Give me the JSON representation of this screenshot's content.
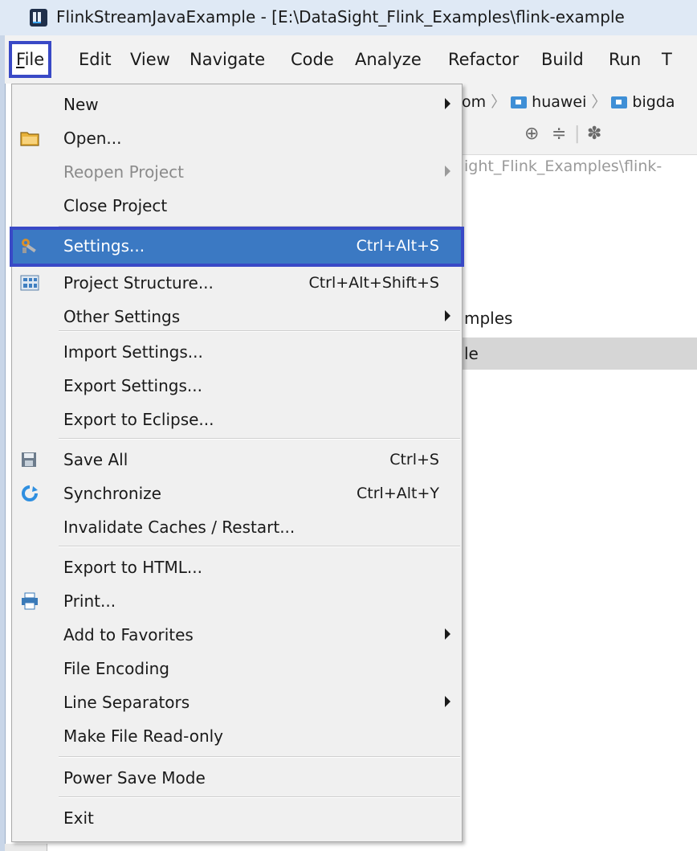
{
  "window": {
    "title": "FlinkStreamJavaExample - [E:\\DataSight_Flink_Examples\\flink-example"
  },
  "menubar": {
    "items": [
      {
        "label": "File",
        "active": true
      },
      {
        "label": "Edit"
      },
      {
        "label": "View"
      },
      {
        "label": "Navigate"
      },
      {
        "label": "Code"
      },
      {
        "label": "Analyze"
      },
      {
        "label": "Refactor"
      },
      {
        "label": "Build"
      },
      {
        "label": "Run"
      },
      {
        "label": "T"
      }
    ]
  },
  "background": {
    "breadcrumbs": [
      "om",
      "huawei",
      "bigda"
    ],
    "path_text": "ight_Flink_Examples\\flink-",
    "tree_items": [
      "mples",
      "le"
    ]
  },
  "file_menu": {
    "items": {
      "new": {
        "label": "New",
        "submenu": true
      },
      "open": {
        "label": "Open...",
        "icon": "folder-icon"
      },
      "reopen_project": {
        "label": "Reopen Project",
        "disabled": true,
        "submenu": true
      },
      "close_project": {
        "label": "Close Project"
      },
      "settings": {
        "label": "Settings...",
        "shortcut": "Ctrl+Alt+S",
        "icon": "settings-wrench-icon",
        "highlighted": true
      },
      "project_structure": {
        "label": "Project Structure...",
        "shortcut": "Ctrl+Alt+Shift+S",
        "icon": "project-structure-icon"
      },
      "other_settings": {
        "label": "Other Settings",
        "submenu": true
      },
      "import_settings": {
        "label": "Import Settings..."
      },
      "export_settings": {
        "label": "Export Settings..."
      },
      "export_to_eclipse": {
        "label": "Export to Eclipse..."
      },
      "save_all": {
        "label": "Save All",
        "shortcut": "Ctrl+S",
        "icon": "save-icon"
      },
      "synchronize": {
        "label": "Synchronize",
        "shortcut": "Ctrl+Alt+Y",
        "icon": "sync-icon"
      },
      "invalidate_caches": {
        "label": "Invalidate Caches / Restart..."
      },
      "export_to_html": {
        "label": "Export to HTML..."
      },
      "print": {
        "label": "Print...",
        "icon": "print-icon"
      },
      "add_to_favorites": {
        "label": "Add to Favorites",
        "submenu": true
      },
      "file_encoding": {
        "label": "File Encoding"
      },
      "line_separators": {
        "label": "Line Separators",
        "submenu": true
      },
      "make_read_only": {
        "label": "Make File Read-only"
      },
      "power_save_mode": {
        "label": "Power Save Mode"
      },
      "exit": {
        "label": "Exit"
      }
    }
  },
  "colors": {
    "highlight": "#3b79c3",
    "annotation_box": "#3949c6",
    "menu_bg": "#f0f0f0"
  }
}
